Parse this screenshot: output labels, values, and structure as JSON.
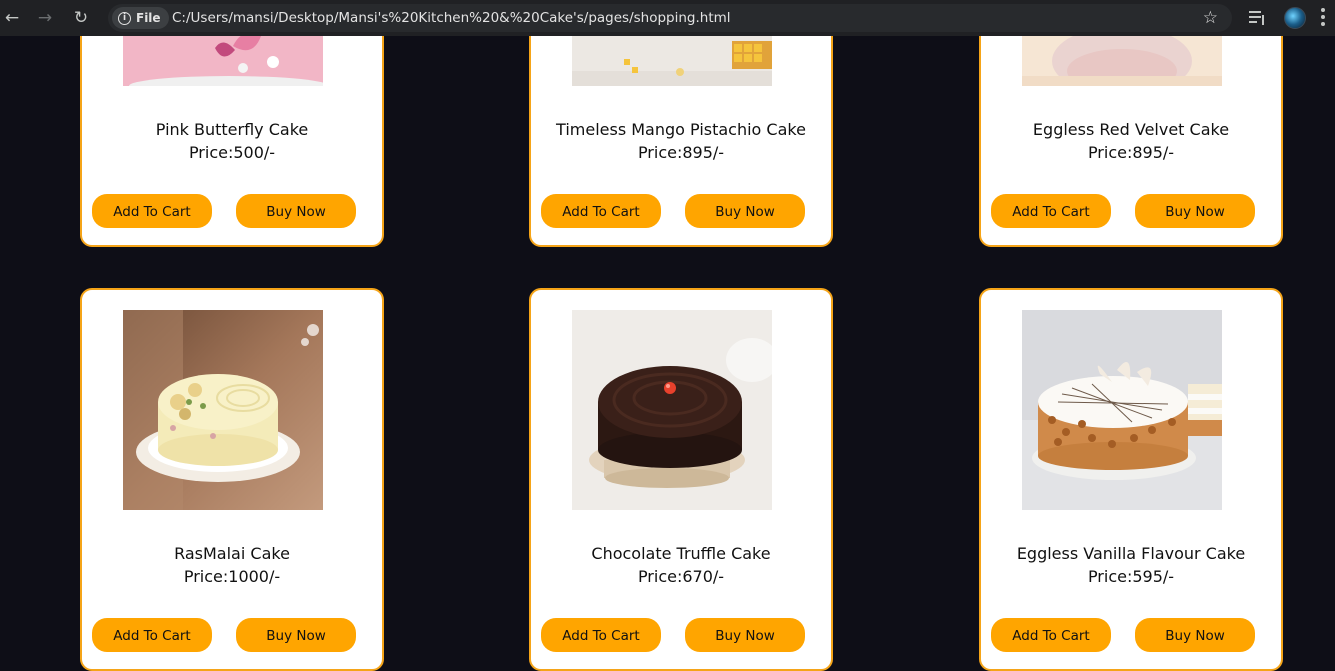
{
  "browser": {
    "chip_label": "File",
    "url": "C:/Users/mansi/Desktop/Mansi's%20Kitchen%20&%20Cake's/pages/shopping.html"
  },
  "products": [
    {
      "name": "Pink Butterfly Cake",
      "price": "Price:500/-",
      "cart_label": "Add To Cart",
      "buy_label": "Buy Now"
    },
    {
      "name": "Timeless Mango Pistachio Cake",
      "price": "Price:895/-",
      "cart_label": "Add To Cart",
      "buy_label": "Buy Now"
    },
    {
      "name": "Eggless Red Velvet Cake",
      "price": "Price:895/-",
      "cart_label": "Add To Cart",
      "buy_label": "Buy Now"
    },
    {
      "name": "RasMalai Cake",
      "price": "Price:1000/-",
      "cart_label": "Add To Cart",
      "buy_label": "Buy Now"
    },
    {
      "name": "Chocolate Truffle Cake",
      "price": "Price:670/-",
      "cart_label": "Add To Cart",
      "buy_label": "Buy Now"
    },
    {
      "name": "Eggless Vanilla Flavour Cake",
      "price": "Price:595/-",
      "cart_label": "Add To Cart",
      "buy_label": "Buy Now"
    }
  ],
  "colors": {
    "page_background": "#0e0e17",
    "card_border": "#f5a418",
    "button": "#ffa500"
  }
}
